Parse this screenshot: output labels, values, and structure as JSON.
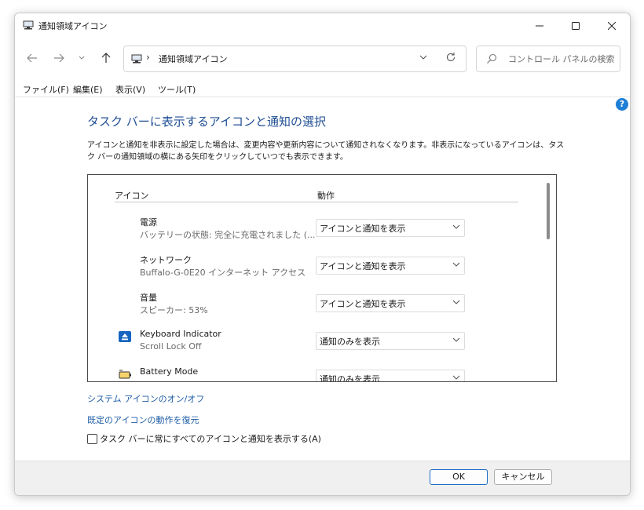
{
  "window": {
    "title": "通知領域アイコン",
    "icon": "computer-icon",
    "controls": [
      "minimize-icon",
      "maximize-icon",
      "close-icon"
    ]
  },
  "nav": {
    "back_icon": "arrow-left-icon",
    "forward_icon": "arrow-right-icon",
    "recent_icon": "chevron-down-icon",
    "up_icon": "arrow-up-icon",
    "address_separator": "›",
    "address_text": "通知領域アイコン",
    "refresh_icon": "refresh-icon",
    "search_placeholder": "コントロール パネルの検索"
  },
  "menu": [
    "ファイル(F)",
    "編集(E)",
    "表示(V)",
    "ツール(T)"
  ],
  "help_label": "?",
  "main": {
    "heading": "タスク バーに表示するアイコンと通知の選択",
    "description": "アイコンと通知を非表示に設定した場合は、変更内容や更新内容について通知されなくなります。非表示になっているアイコンは、タスク バーの通知領域の横にある矢印をクリックしていつでも表示できます。",
    "col_icon": "アイコン",
    "col_action": "動作",
    "rows": [
      {
        "name": "電源",
        "sub": "バッテリーの状態: 完全に充電されました (...",
        "action": "アイコンと通知を表示",
        "icon": "none"
      },
      {
        "name": "ネットワーク",
        "sub": "Buffalo-G-0E20 インターネット アクセス",
        "action": "アイコンと通知を表示",
        "icon": "none"
      },
      {
        "name": "音量",
        "sub": "スピーカー: 53%",
        "action": "アイコンと通知を表示",
        "icon": "none"
      },
      {
        "name": "Keyboard Indicator",
        "sub": "Scroll Lock Off",
        "action": "通知のみを表示",
        "icon": "keyboard-indicator-icon"
      },
      {
        "name": "Battery Mode",
        "sub": "",
        "action": "通知のみを表示",
        "icon": "battery-icon"
      }
    ],
    "link_system_icons": "システム アイコンのオン/オフ",
    "link_restore": "既定のアイコンの動作を復元",
    "checkbox_label": "タスク バーに常にすべてのアイコンと通知を表示する(A)",
    "checkbox_checked": false
  },
  "footer": {
    "ok": "OK",
    "cancel": "キャンセル"
  },
  "colors": {
    "link": "#1f5ea8",
    "heading": "#1f4e94",
    "accent": "#1e7fd6"
  }
}
